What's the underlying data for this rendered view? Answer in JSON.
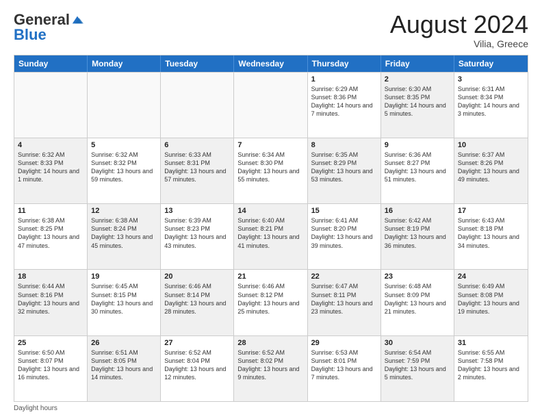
{
  "logo": {
    "general": "General",
    "blue": "Blue"
  },
  "title": "August 2024",
  "location": "Vilia, Greece",
  "header_days": [
    "Sunday",
    "Monday",
    "Tuesday",
    "Wednesday",
    "Thursday",
    "Friday",
    "Saturday"
  ],
  "footer": "Daylight hours",
  "weeks": [
    [
      {
        "day": "",
        "sunrise": "",
        "sunset": "",
        "daylight": "",
        "shaded": false,
        "empty": true
      },
      {
        "day": "",
        "sunrise": "",
        "sunset": "",
        "daylight": "",
        "shaded": false,
        "empty": true
      },
      {
        "day": "",
        "sunrise": "",
        "sunset": "",
        "daylight": "",
        "shaded": false,
        "empty": true
      },
      {
        "day": "",
        "sunrise": "",
        "sunset": "",
        "daylight": "",
        "shaded": false,
        "empty": true
      },
      {
        "day": "1",
        "sunrise": "Sunrise: 6:29 AM",
        "sunset": "Sunset: 8:36 PM",
        "daylight": "Daylight: 14 hours and 7 minutes.",
        "shaded": false,
        "empty": false
      },
      {
        "day": "2",
        "sunrise": "Sunrise: 6:30 AM",
        "sunset": "Sunset: 8:35 PM",
        "daylight": "Daylight: 14 hours and 5 minutes.",
        "shaded": true,
        "empty": false
      },
      {
        "day": "3",
        "sunrise": "Sunrise: 6:31 AM",
        "sunset": "Sunset: 8:34 PM",
        "daylight": "Daylight: 14 hours and 3 minutes.",
        "shaded": false,
        "empty": false
      }
    ],
    [
      {
        "day": "4",
        "sunrise": "Sunrise: 6:32 AM",
        "sunset": "Sunset: 8:33 PM",
        "daylight": "Daylight: 14 hours and 1 minute.",
        "shaded": true,
        "empty": false
      },
      {
        "day": "5",
        "sunrise": "Sunrise: 6:32 AM",
        "sunset": "Sunset: 8:32 PM",
        "daylight": "Daylight: 13 hours and 59 minutes.",
        "shaded": false,
        "empty": false
      },
      {
        "day": "6",
        "sunrise": "Sunrise: 6:33 AM",
        "sunset": "Sunset: 8:31 PM",
        "daylight": "Daylight: 13 hours and 57 minutes.",
        "shaded": true,
        "empty": false
      },
      {
        "day": "7",
        "sunrise": "Sunrise: 6:34 AM",
        "sunset": "Sunset: 8:30 PM",
        "daylight": "Daylight: 13 hours and 55 minutes.",
        "shaded": false,
        "empty": false
      },
      {
        "day": "8",
        "sunrise": "Sunrise: 6:35 AM",
        "sunset": "Sunset: 8:29 PM",
        "daylight": "Daylight: 13 hours and 53 minutes.",
        "shaded": true,
        "empty": false
      },
      {
        "day": "9",
        "sunrise": "Sunrise: 6:36 AM",
        "sunset": "Sunset: 8:27 PM",
        "daylight": "Daylight: 13 hours and 51 minutes.",
        "shaded": false,
        "empty": false
      },
      {
        "day": "10",
        "sunrise": "Sunrise: 6:37 AM",
        "sunset": "Sunset: 8:26 PM",
        "daylight": "Daylight: 13 hours and 49 minutes.",
        "shaded": true,
        "empty": false
      }
    ],
    [
      {
        "day": "11",
        "sunrise": "Sunrise: 6:38 AM",
        "sunset": "Sunset: 8:25 PM",
        "daylight": "Daylight: 13 hours and 47 minutes.",
        "shaded": false,
        "empty": false
      },
      {
        "day": "12",
        "sunrise": "Sunrise: 6:38 AM",
        "sunset": "Sunset: 8:24 PM",
        "daylight": "Daylight: 13 hours and 45 minutes.",
        "shaded": true,
        "empty": false
      },
      {
        "day": "13",
        "sunrise": "Sunrise: 6:39 AM",
        "sunset": "Sunset: 8:23 PM",
        "daylight": "Daylight: 13 hours and 43 minutes.",
        "shaded": false,
        "empty": false
      },
      {
        "day": "14",
        "sunrise": "Sunrise: 6:40 AM",
        "sunset": "Sunset: 8:21 PM",
        "daylight": "Daylight: 13 hours and 41 minutes.",
        "shaded": true,
        "empty": false
      },
      {
        "day": "15",
        "sunrise": "Sunrise: 6:41 AM",
        "sunset": "Sunset: 8:20 PM",
        "daylight": "Daylight: 13 hours and 39 minutes.",
        "shaded": false,
        "empty": false
      },
      {
        "day": "16",
        "sunrise": "Sunrise: 6:42 AM",
        "sunset": "Sunset: 8:19 PM",
        "daylight": "Daylight: 13 hours and 36 minutes.",
        "shaded": true,
        "empty": false
      },
      {
        "day": "17",
        "sunrise": "Sunrise: 6:43 AM",
        "sunset": "Sunset: 8:18 PM",
        "daylight": "Daylight: 13 hours and 34 minutes.",
        "shaded": false,
        "empty": false
      }
    ],
    [
      {
        "day": "18",
        "sunrise": "Sunrise: 6:44 AM",
        "sunset": "Sunset: 8:16 PM",
        "daylight": "Daylight: 13 hours and 32 minutes.",
        "shaded": true,
        "empty": false
      },
      {
        "day": "19",
        "sunrise": "Sunrise: 6:45 AM",
        "sunset": "Sunset: 8:15 PM",
        "daylight": "Daylight: 13 hours and 30 minutes.",
        "shaded": false,
        "empty": false
      },
      {
        "day": "20",
        "sunrise": "Sunrise: 6:46 AM",
        "sunset": "Sunset: 8:14 PM",
        "daylight": "Daylight: 13 hours and 28 minutes.",
        "shaded": true,
        "empty": false
      },
      {
        "day": "21",
        "sunrise": "Sunrise: 6:46 AM",
        "sunset": "Sunset: 8:12 PM",
        "daylight": "Daylight: 13 hours and 25 minutes.",
        "shaded": false,
        "empty": false
      },
      {
        "day": "22",
        "sunrise": "Sunrise: 6:47 AM",
        "sunset": "Sunset: 8:11 PM",
        "daylight": "Daylight: 13 hours and 23 minutes.",
        "shaded": true,
        "empty": false
      },
      {
        "day": "23",
        "sunrise": "Sunrise: 6:48 AM",
        "sunset": "Sunset: 8:09 PM",
        "daylight": "Daylight: 13 hours and 21 minutes.",
        "shaded": false,
        "empty": false
      },
      {
        "day": "24",
        "sunrise": "Sunrise: 6:49 AM",
        "sunset": "Sunset: 8:08 PM",
        "daylight": "Daylight: 13 hours and 19 minutes.",
        "shaded": true,
        "empty": false
      }
    ],
    [
      {
        "day": "25",
        "sunrise": "Sunrise: 6:50 AM",
        "sunset": "Sunset: 8:07 PM",
        "daylight": "Daylight: 13 hours and 16 minutes.",
        "shaded": false,
        "empty": false
      },
      {
        "day": "26",
        "sunrise": "Sunrise: 6:51 AM",
        "sunset": "Sunset: 8:05 PM",
        "daylight": "Daylight: 13 hours and 14 minutes.",
        "shaded": true,
        "empty": false
      },
      {
        "day": "27",
        "sunrise": "Sunrise: 6:52 AM",
        "sunset": "Sunset: 8:04 PM",
        "daylight": "Daylight: 13 hours and 12 minutes.",
        "shaded": false,
        "empty": false
      },
      {
        "day": "28",
        "sunrise": "Sunrise: 6:52 AM",
        "sunset": "Sunset: 8:02 PM",
        "daylight": "Daylight: 13 hours and 9 minutes.",
        "shaded": true,
        "empty": false
      },
      {
        "day": "29",
        "sunrise": "Sunrise: 6:53 AM",
        "sunset": "Sunset: 8:01 PM",
        "daylight": "Daylight: 13 hours and 7 minutes.",
        "shaded": false,
        "empty": false
      },
      {
        "day": "30",
        "sunrise": "Sunrise: 6:54 AM",
        "sunset": "Sunset: 7:59 PM",
        "daylight": "Daylight: 13 hours and 5 minutes.",
        "shaded": true,
        "empty": false
      },
      {
        "day": "31",
        "sunrise": "Sunrise: 6:55 AM",
        "sunset": "Sunset: 7:58 PM",
        "daylight": "Daylight: 13 hours and 2 minutes.",
        "shaded": false,
        "empty": false
      }
    ]
  ]
}
